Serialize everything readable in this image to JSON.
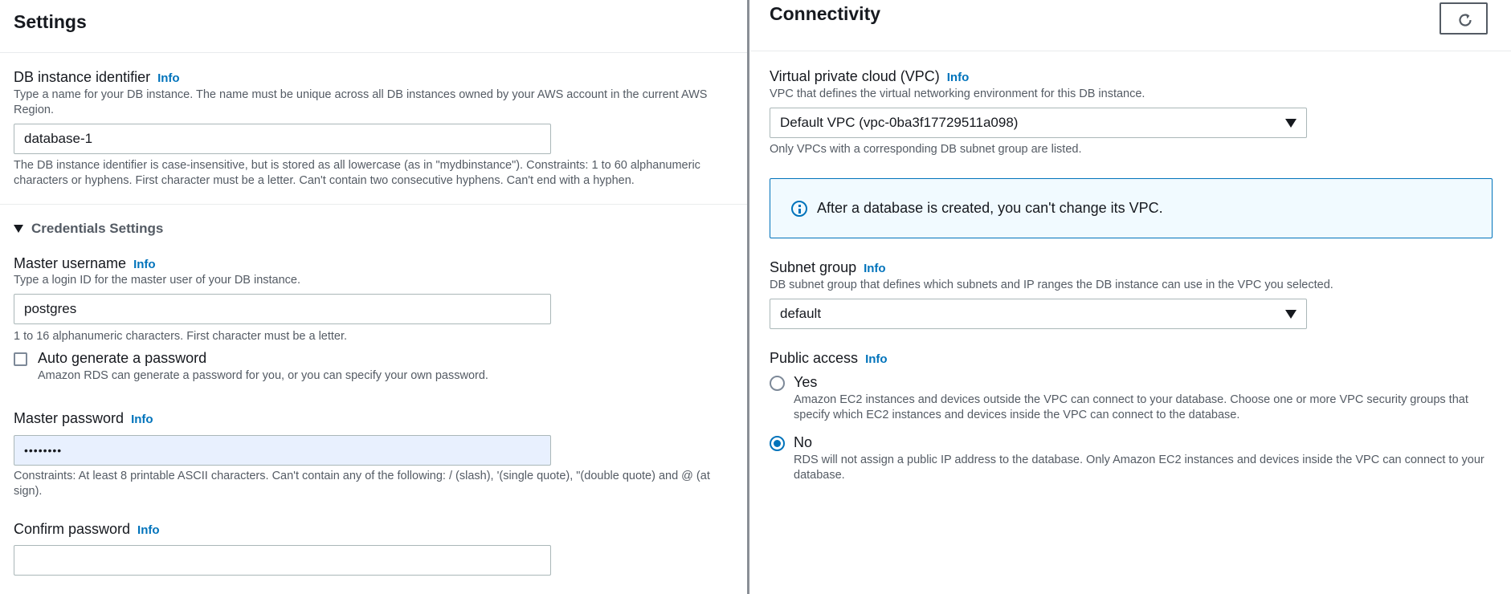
{
  "settings": {
    "title": "Settings",
    "db_identifier": {
      "label": "DB instance identifier",
      "info": "Info",
      "description": "Type a name for your DB instance. The name must be unique across all DB instances owned by your AWS account in the current AWS Region.",
      "value": "database-1",
      "constraint": "The DB instance identifier is case-insensitive, but is stored as all lowercase (as in \"mydbinstance\"). Constraints: 1 to 60 alphanumeric characters or hyphens. First character must be a letter. Can't contain two consecutive hyphens. Can't end with a hyphen."
    },
    "credentials": {
      "section_label": "Credentials Settings",
      "master_username": {
        "label": "Master username",
        "info": "Info",
        "description": "Type a login ID for the master user of your DB instance.",
        "value": "postgres",
        "constraint": "1 to 16 alphanumeric characters. First character must be a letter."
      },
      "auto_generate": {
        "label": "Auto generate a password",
        "description": "Amazon RDS can generate a password for you, or you can specify your own password.",
        "checked": false
      },
      "master_password": {
        "label": "Master password",
        "info": "Info",
        "value": "••••••••",
        "constraint": "Constraints: At least 8 printable ASCII characters. Can't contain any of the following: / (slash), '(single quote), \"(double quote) and @ (at sign)."
      },
      "confirm_password": {
        "label": "Confirm password",
        "info": "Info",
        "value": ""
      }
    }
  },
  "connectivity": {
    "title": "Connectivity",
    "refresh_icon": "refresh-icon",
    "vpc": {
      "label": "Virtual private cloud (VPC)",
      "info": "Info",
      "description": "VPC that defines the virtual networking environment for this DB instance.",
      "value": "Default VPC (vpc-0ba3f17729511a098)",
      "note": "Only VPCs with a corresponding DB subnet group are listed."
    },
    "alert": {
      "icon": "info-circle-icon",
      "text": "After a database is created, you can't change its VPC."
    },
    "subnet_group": {
      "label": "Subnet group",
      "info": "Info",
      "description": "DB subnet group that defines which subnets and IP ranges the DB instance can use in the VPC you selected.",
      "value": "default"
    },
    "public_access": {
      "label": "Public access",
      "info": "Info",
      "options": [
        {
          "label": "Yes",
          "description": "Amazon EC2 instances and devices outside the VPC can connect to your database. Choose one or more VPC security groups that specify which EC2 instances and devices inside the VPC can connect to the database.",
          "selected": false
        },
        {
          "label": "No",
          "description": "RDS will not assign a public IP address to the database. Only Amazon EC2 instances and devices inside the VPC can connect to your database.",
          "selected": true
        }
      ]
    }
  },
  "colors": {
    "link": "#0073bb",
    "text": "#16191f",
    "secondary_text": "#545b64",
    "focused_input_bg": "#e8f0fe",
    "alert_bg": "#f1faff"
  }
}
